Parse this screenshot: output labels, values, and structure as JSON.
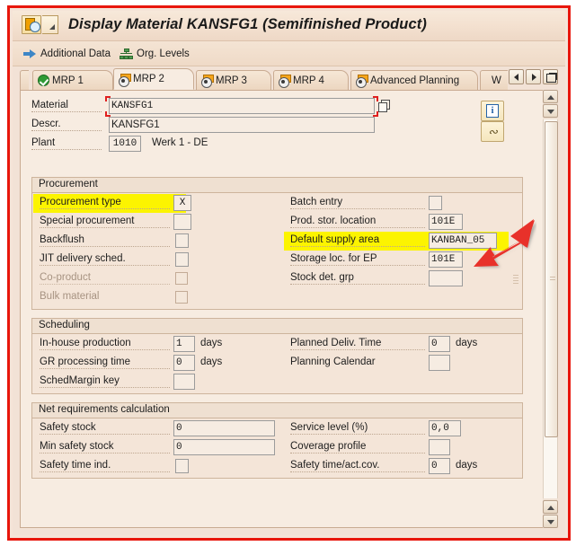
{
  "window": {
    "title": "Display Material KANSFG1 (Semifinished Product)",
    "app_icon": "sap-material-icon",
    "menu_icon": "menu-arrow-icon"
  },
  "toolbar": {
    "buttons": [
      {
        "label": "Additional Data",
        "icon": "blue-arrow-icon"
      },
      {
        "label": "Org. Levels",
        "icon": "org-levels-icon"
      }
    ]
  },
  "tabs": {
    "items": [
      {
        "label": "MRP 1",
        "icon": "green-check-icon",
        "active": false
      },
      {
        "label": "MRP 2",
        "icon": "page-radio-icon",
        "active": true
      },
      {
        "label": "MRP 3",
        "icon": "page-radio-icon",
        "active": false
      },
      {
        "label": "MRP 4",
        "icon": "page-radio-icon",
        "active": false
      },
      {
        "label": "Advanced Planning",
        "icon": "page-radio-icon",
        "active": false
      },
      {
        "label": "W",
        "icon": "none",
        "active": false
      }
    ],
    "nav": {
      "prev": "scroll-left-icon",
      "next": "scroll-right-icon",
      "list": "tab-list-icon"
    }
  },
  "header": {
    "material": {
      "label": "Material",
      "value": "KANSFG1",
      "focused": true,
      "value_help": "value-help-icon"
    },
    "descr": {
      "label": "Descr.",
      "value": "KANSFG1"
    },
    "plant": {
      "label": "Plant",
      "value": "1010",
      "text": "Werk 1 - DE"
    },
    "side_buttons": [
      {
        "name": "info-button",
        "icon": "info-icon"
      },
      {
        "name": "long-text-button",
        "icon": "signature-icon"
      }
    ]
  },
  "groups": [
    {
      "title": "Procurement",
      "left_fields": [
        {
          "label": "Procurement type",
          "value": "X",
          "type": "text",
          "highlight": true
        },
        {
          "label": "Special procurement",
          "value": "",
          "type": "text",
          "highlight": false
        },
        {
          "label": "Backflush",
          "value": "",
          "type": "checkbox",
          "highlight": false
        },
        {
          "label": "JIT delivery sched.",
          "value": "",
          "type": "checkbox",
          "highlight": false
        },
        {
          "label": "Co-product",
          "value": "",
          "type": "checkbox",
          "highlight": false,
          "disabled": true
        },
        {
          "label": "Bulk material",
          "value": "",
          "type": "checkbox",
          "highlight": false,
          "disabled": true
        }
      ],
      "right_fields": [
        {
          "label": "Batch entry",
          "value": "",
          "type": "text",
          "highlight": false
        },
        {
          "label": "Prod. stor. location",
          "value": "101E",
          "type": "text",
          "highlight": false
        },
        {
          "label": "Default supply area",
          "value": "KANBAN_05",
          "type": "text",
          "highlight": true
        },
        {
          "label": "Storage loc. for EP",
          "value": "101E",
          "type": "text",
          "highlight": false
        },
        {
          "label": "Stock det. grp",
          "value": "",
          "type": "text",
          "highlight": false
        }
      ]
    },
    {
      "title": "Scheduling",
      "left_fields": [
        {
          "label": "In-house production",
          "value": "1",
          "unit": "days"
        },
        {
          "label": "GR processing time",
          "value": "0",
          "unit": "days"
        },
        {
          "label": "SchedMargin key",
          "value": "",
          "unit": ""
        }
      ],
      "right_fields": [
        {
          "label": "Planned Deliv. Time",
          "value": "0",
          "unit": "days"
        },
        {
          "label": "Planning Calendar",
          "value": "",
          "unit": ""
        }
      ]
    },
    {
      "title": "Net requirements calculation",
      "left_fields": [
        {
          "label": "Safety stock",
          "value": "0",
          "unit": ""
        },
        {
          "label": "Min safety stock",
          "value": "0",
          "unit": ""
        },
        {
          "label": "Safety time ind.",
          "value": "",
          "unit": ""
        }
      ],
      "right_fields": [
        {
          "label": "Service level (%)",
          "value": "0,0",
          "unit": ""
        },
        {
          "label": "Coverage profile",
          "value": "",
          "unit": ""
        },
        {
          "label": "Safety time/act.cov.",
          "value": "0",
          "unit": "days"
        }
      ]
    }
  ],
  "annotation": {
    "arrow": "red-arrow-pointing-to-default-supply-area",
    "frame_color": "#e8160c",
    "highlight_color": "#fcf400"
  }
}
